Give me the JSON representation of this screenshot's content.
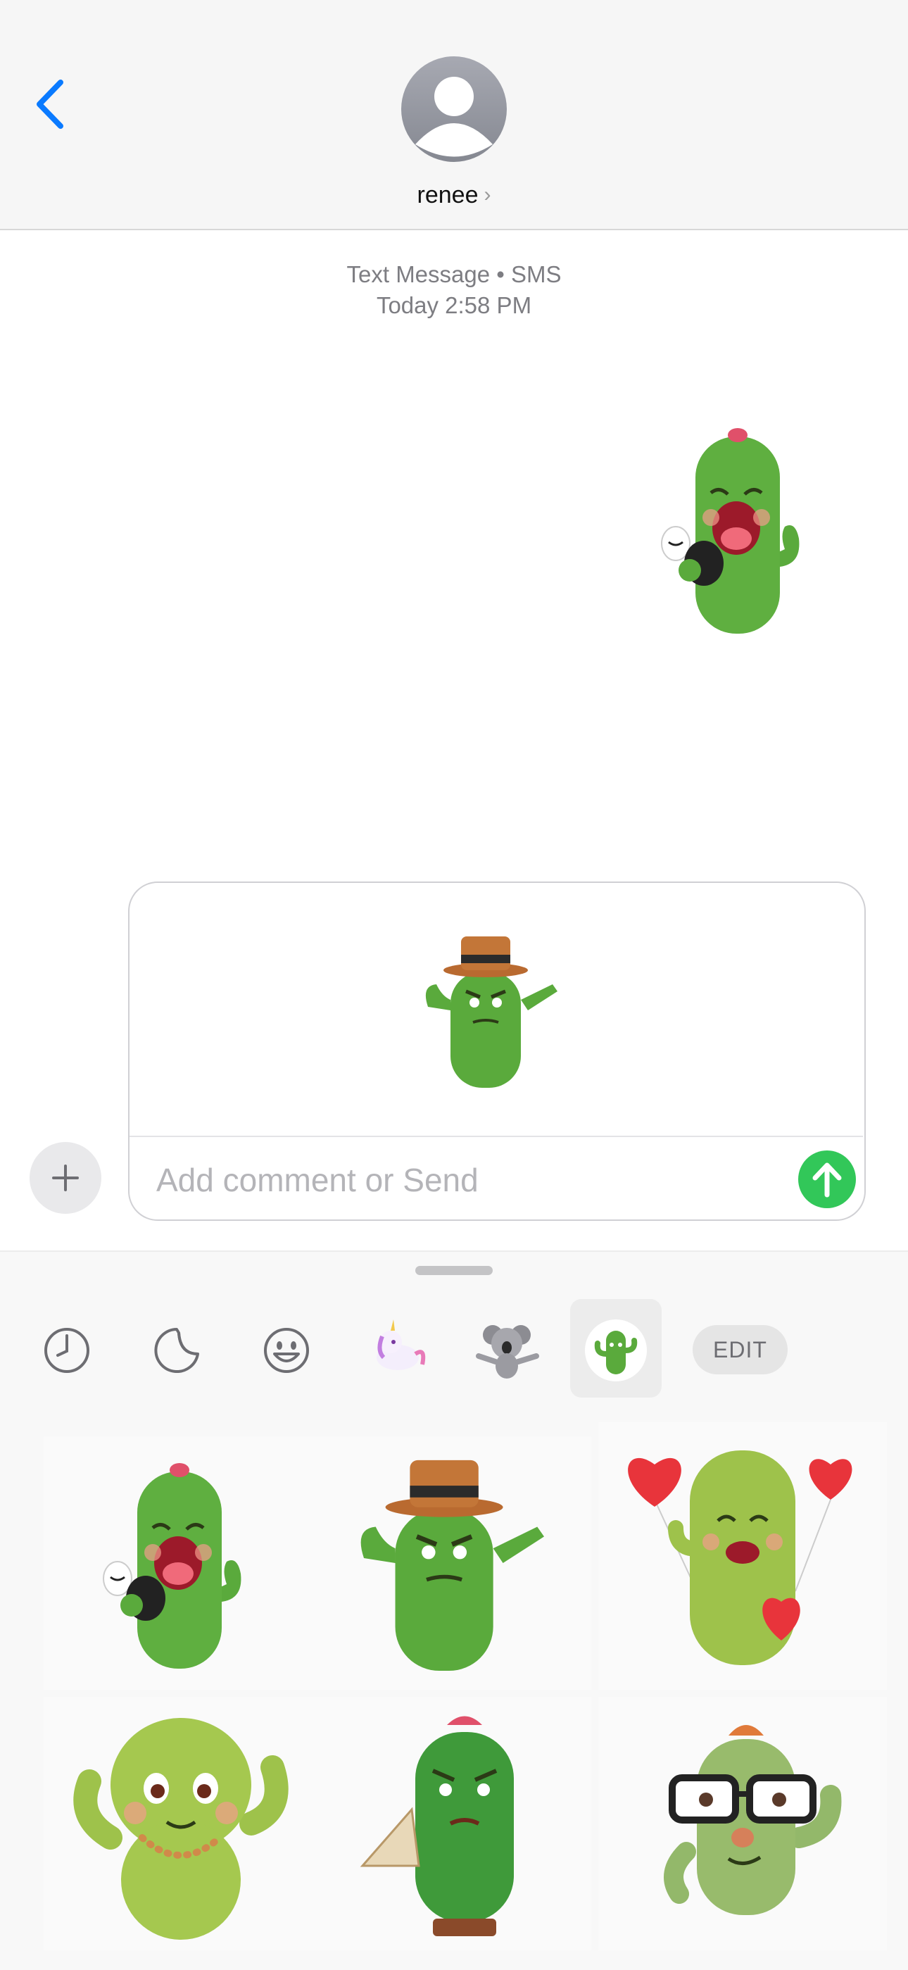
{
  "header": {
    "contact_name": "renee",
    "chevron": "›"
  },
  "conversation": {
    "service": "Text Message • SMS",
    "timestamp": "Today 2:58 PM"
  },
  "compose": {
    "placeholder": "Add comment or Send"
  },
  "drawer": {
    "tabs": [
      "recents-clock-icon",
      "stickers-icon",
      "emoji-icon",
      "unicorn-sticker-pack",
      "koala-sticker-pack",
      "cactus-sticker-pack"
    ],
    "active_tab": "cactus-sticker-pack",
    "edit_label": "EDIT"
  },
  "colors": {
    "ios_blue": "#0a7aff",
    "send_green": "#32c759",
    "cactus_green": "#5aaa3c",
    "heart_red": "#e8343b"
  }
}
